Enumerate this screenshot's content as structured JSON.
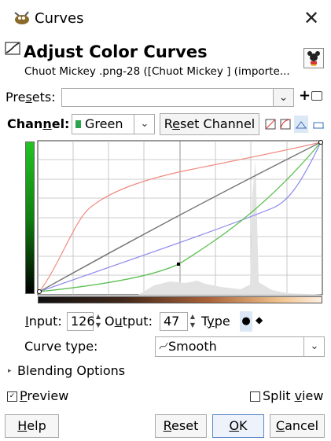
{
  "window": {
    "title": "Curves",
    "close_symbol": "✕"
  },
  "header": {
    "title": "Adjust Color Curves",
    "subtitle": "Chuot Mickey .png-28 ([Chuot Mickey ] (importe..."
  },
  "presets": {
    "label_pre": "Pre",
    "label_u": "s",
    "label_post": "ets:",
    "value": ""
  },
  "channel": {
    "label_pre": "Chan",
    "label_u": "n",
    "label_post": "el:",
    "value": "Green",
    "swatch_color": "#2ea44f"
  },
  "reset_channel": {
    "label_pre": "R",
    "label_u": "e",
    "label_post": "set Channel"
  },
  "curve_colors": {
    "red": "#f08a80",
    "green": "#5cc050",
    "blue": "#8a86ee",
    "value": "#777777"
  },
  "point": {
    "input_label_u": "I",
    "input_label_rest": "nput:",
    "input": "126",
    "output_label_pre": "O",
    "output_label_u": "u",
    "output_label_post": "tput:",
    "output": "47",
    "type_label_pre": "T",
    "type_label_u": "y",
    "type_label_post": "pe",
    "type_smooth_symbol": "●",
    "type_corner_symbol": "◆"
  },
  "curve_type": {
    "label": "Curve type:",
    "value": "Smooth"
  },
  "blending": {
    "label": "Blending Options"
  },
  "preview": {
    "label_u": "P",
    "label_rest": "review",
    "checked": true
  },
  "split_view": {
    "label_pre": "Split ",
    "label_u": "v",
    "label_post": "iew",
    "checked": false
  },
  "buttons": {
    "help": {
      "u": "H",
      "rest": "elp"
    },
    "reset": {
      "u": "R",
      "rest": "eset"
    },
    "ok": {
      "u": "O",
      "rest": "K"
    },
    "cancel": {
      "u": "C",
      "rest": "ancel"
    }
  }
}
